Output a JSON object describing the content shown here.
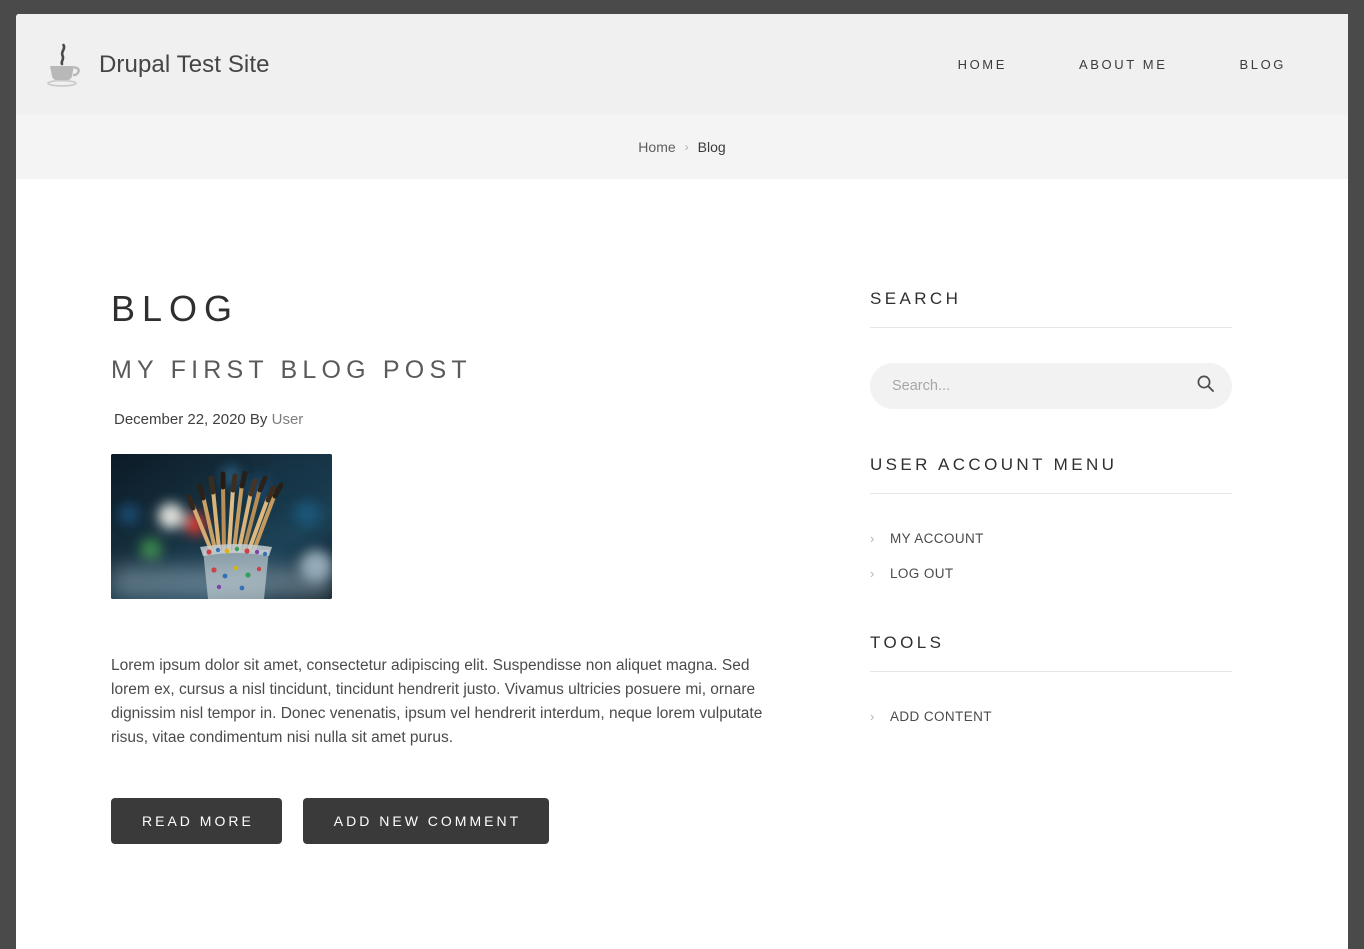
{
  "header": {
    "logo_icon": "coffee-cup-icon",
    "site_title": "Drupal Test Site",
    "nav": [
      {
        "label": "HOME"
      },
      {
        "label": "ABOUT ME"
      },
      {
        "label": "BLOG"
      }
    ]
  },
  "breadcrumb": {
    "home_label": "Home",
    "separator": "›",
    "current_label": "Blog"
  },
  "main": {
    "page_title": "BLOG",
    "post": {
      "title": "MY FIRST BLOG POST",
      "date": "December 22, 2020",
      "by_word": "By",
      "author": "User",
      "image_alt": "paintbrushes-in-jar-photo",
      "body": "Lorem ipsum dolor sit amet, consectetur adipiscing elit. Suspendisse non aliquet magna. Sed lorem ex, cursus a nisl tincidunt, tincidunt hendrerit justo. Vivamus ultricies posuere mi, ornare dignissim nisl tempor in. Donec venenatis, ipsum vel hendrerit interdum, neque lorem vulputate risus, vitae condimentum nisi nulla sit amet purus.",
      "read_more_label": "READ MORE",
      "add_comment_label": "ADD NEW COMMENT"
    }
  },
  "sidebar": {
    "search_block": {
      "heading": "SEARCH",
      "placeholder": "Search...",
      "value": "",
      "icon": "search-icon"
    },
    "account_block": {
      "heading": "USER ACCOUNT MENU",
      "items": [
        {
          "label": "MY ACCOUNT",
          "icon": "chevron-right-icon"
        },
        {
          "label": "LOG OUT",
          "icon": "chevron-right-icon"
        }
      ]
    },
    "tools_block": {
      "heading": "TOOLS",
      "items": [
        {
          "label": "ADD CONTENT",
          "icon": "chevron-right-icon"
        }
      ]
    }
  },
  "colors": {
    "outer_background": "#4a4a4a",
    "header_background": "#f0f0f0",
    "breadcrumb_background": "#f4f4f4",
    "page_background": "#ffffff",
    "button_background": "#3a3a3a",
    "text_primary": "#2f2f2f",
    "text_muted": "#7d7d7d",
    "rule": "#e6e6e6"
  }
}
